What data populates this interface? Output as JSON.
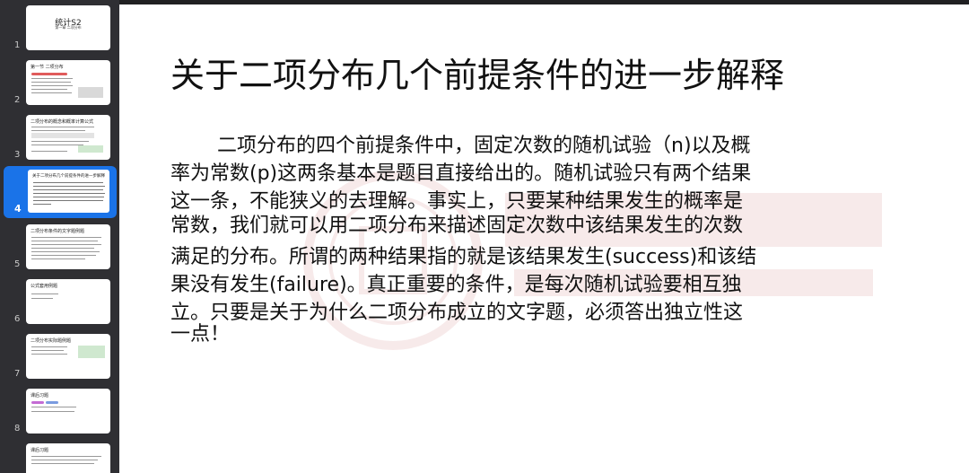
{
  "thumbnails": [
    {
      "num": "1",
      "title": "统计S2",
      "subtitle": "第一章 二项分布"
    },
    {
      "num": "2",
      "title": "第一节 二项分布"
    },
    {
      "num": "3",
      "title": "二项分布的概念和概率计算公式"
    },
    {
      "num": "4",
      "title": "关于二项分布几个前提条件的进一步解释"
    },
    {
      "num": "5",
      "title": "二项分布条件的文字题例题"
    },
    {
      "num": "6",
      "title": "公式套用例题"
    },
    {
      "num": "7",
      "title": "二项分布实际题例题"
    },
    {
      "num": "8",
      "title": "课后习题"
    },
    {
      "num": "9",
      "title": "课后习题"
    }
  ],
  "active_index": 3,
  "slide": {
    "title": "关于二项分布几个前提条件的进一步解释",
    "lines": [
      "二项分布的四个前提条件中，固定次数的随机试验（n)以及概",
      "率为常数(p)这两条基本是题目直接给出的。随机试验只有两个结果",
      "这一条，不能狭义的去理解。事实上，只要某种结果发生的概率是",
      "满足的分布。所谓的两种结果指的就是该结果发生(success)和该结",
      "果没有发生(failure)。真正重要的条件，是每次随机试验要相互独",
      "立。只要是关于为什么二项分布成立的文字题，必须答出独立性这"
    ],
    "overlap_lines": [
      "常数，我们就可以用二项分布来描述固定次数中该结果发生的次数",
      "一点！"
    ]
  },
  "colors": {
    "active_thumb": "#1a73e8",
    "panel": "#2f2f33",
    "watermark": "#b22222"
  }
}
